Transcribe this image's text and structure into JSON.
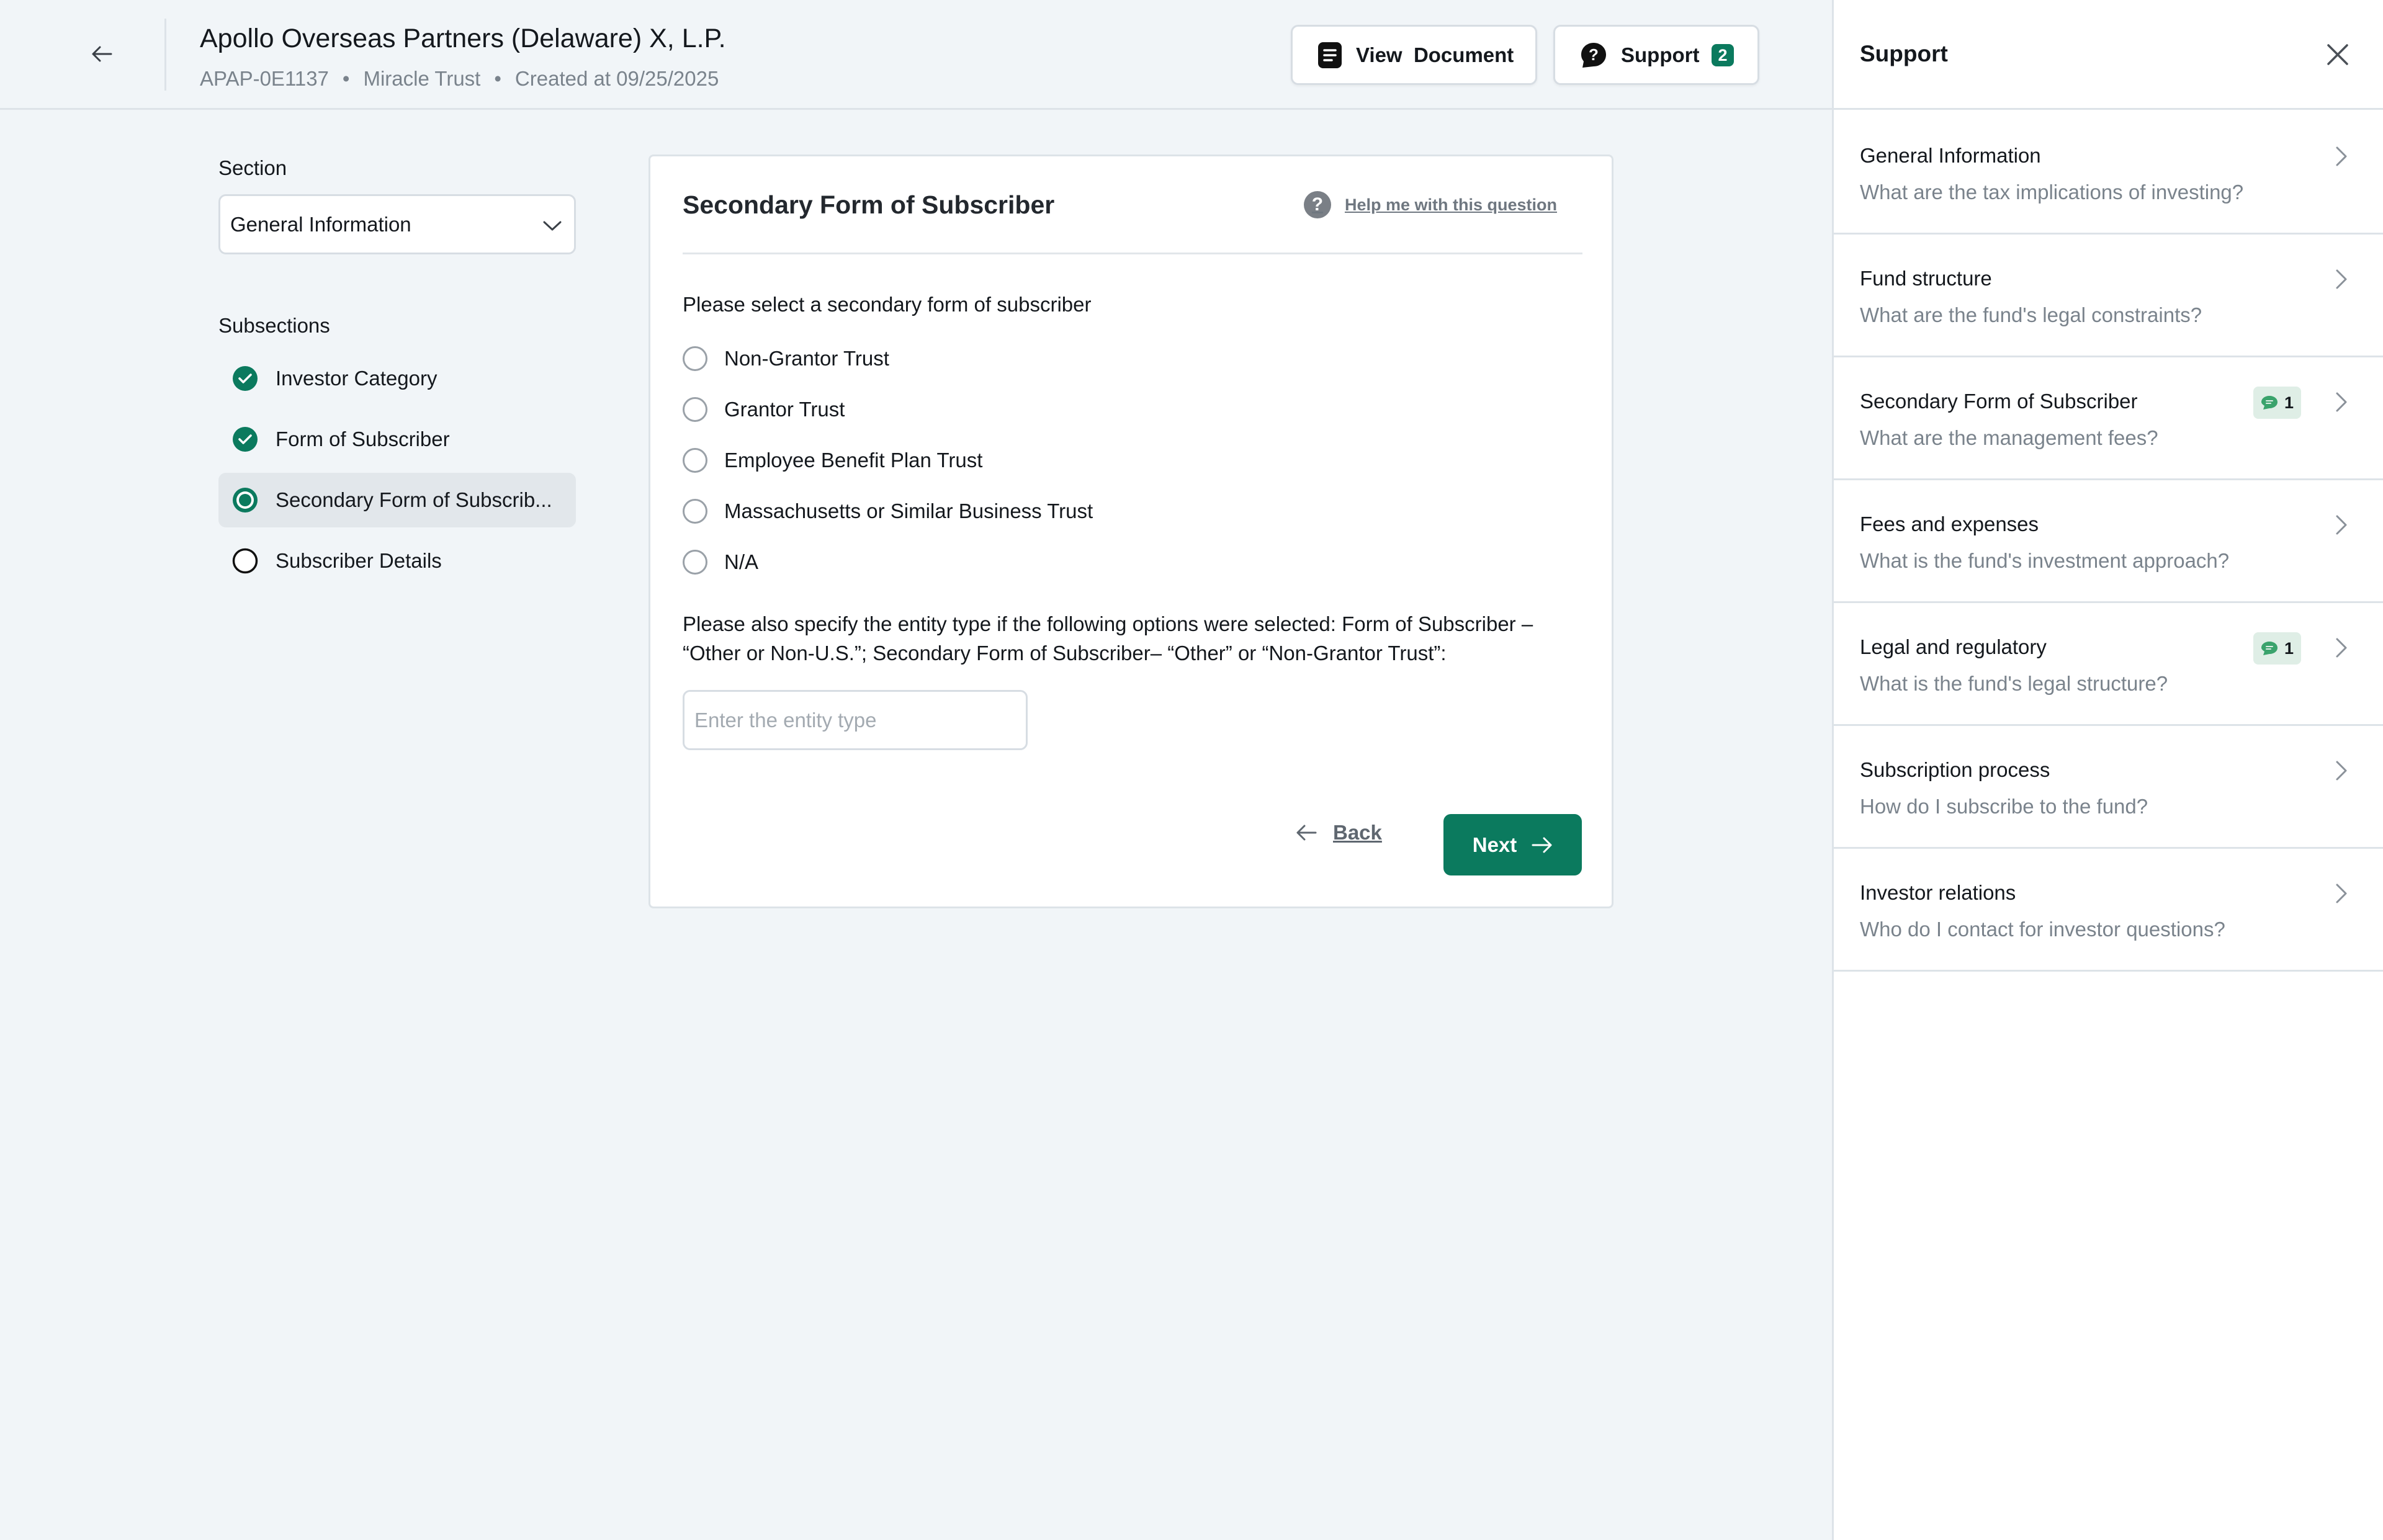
{
  "header": {
    "title": "Apollo Overseas Partners (Delaware) X, L.P.",
    "meta": {
      "id": "APAP-0E1137",
      "entity": "Miracle Trust",
      "created": "Created at 09/25/2025",
      "separator": "•"
    },
    "view_document_label": "View  Document",
    "support_label": "Support",
    "support_count": "2"
  },
  "left_nav": {
    "section_label": "Section",
    "section_value": "General Information",
    "subsections_label": "Subsections",
    "subsections": [
      {
        "label": "Investor Category",
        "status": "complete"
      },
      {
        "label": "Form of Subscriber",
        "status": "complete"
      },
      {
        "label": "Secondary Form of Subscrib...",
        "status": "current"
      },
      {
        "label": "Subscriber Details",
        "status": "pending"
      }
    ]
  },
  "form": {
    "title": "Secondary Form of Subscriber",
    "help_label": "Help me with this question",
    "question": "Please select a secondary form of subscriber",
    "options": [
      "Non-Grantor Trust",
      "Grantor Trust",
      "Employee Benefit Plan Trust",
      "Massachusetts or Similar Business Trust",
      "N/A"
    ],
    "entity_question": "Please also specify the entity type if the following options were selected: Form of Subscriber – “Other or Non-U.S.”; Secondary Form of Subscriber– “Other” or “Non-Grantor Trust”:",
    "entity_placeholder": "Enter the entity type",
    "entity_value": "",
    "back_label": "Back",
    "next_label": "Next"
  },
  "support": {
    "title": "Support",
    "items": [
      {
        "topic": "General Information",
        "question": "What are the tax implications of investing?",
        "badge": ""
      },
      {
        "topic": "Fund structure",
        "question": "What are the fund's legal constraints?",
        "badge": ""
      },
      {
        "topic": "Secondary Form of Subscriber",
        "question": "What are the management fees?",
        "badge": "1"
      },
      {
        "topic": "Fees and expenses",
        "question": "What is the fund's investment approach?",
        "badge": ""
      },
      {
        "topic": "Legal and regulatory",
        "question": "What is the fund's legal structure?",
        "badge": "1"
      },
      {
        "topic": "Subscription process",
        "question": "How do I subscribe to the fund?",
        "badge": ""
      },
      {
        "topic": "Investor relations",
        "question": "Who do I contact for investor questions?",
        "badge": ""
      }
    ]
  },
  "colors": {
    "accent": "#0b7a5e",
    "background": "#f1f5f8",
    "badge_bg": "#dfeee6",
    "badge_icon": "#3aa36c"
  },
  "icons": {
    "back": "arrow-left-icon",
    "view_document": "document-icon",
    "support": "question-icon",
    "select": "chevron-down-icon",
    "complete": "check-circle-icon",
    "current": "current-step-icon",
    "pending": "empty-circle-icon",
    "help": "question-circle-icon",
    "next": "arrow-right-icon",
    "close": "close-icon",
    "faq": "chevron-right-icon",
    "badge": "chat-bubble-icon"
  }
}
